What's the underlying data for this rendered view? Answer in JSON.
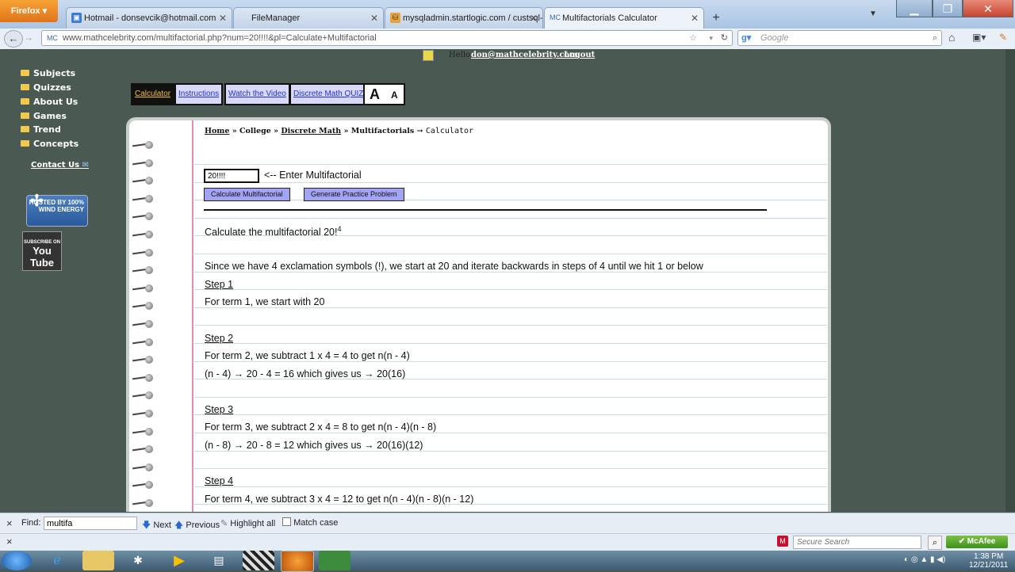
{
  "browser": {
    "menu_button": "Firefox",
    "tabs": [
      {
        "label": "Hotmail - donsevcik@hotmail.com",
        "active": false
      },
      {
        "label": "FileManager",
        "active": false
      },
      {
        "label": "mysqladmin.startlogic.com / custsql-...",
        "active": false
      },
      {
        "label": "Multifactorials Calculator",
        "active": true
      }
    ],
    "new_tab": "+",
    "url": "www.mathcelebrity.com/multifactorial.php?num=20!!!!&pl=Calculate+Multifactorial",
    "search_placeholder": "Google",
    "site_favicon": "MC"
  },
  "header": {
    "hello": "Hello",
    "user_email": "don@mathcelebrity.com",
    "logout": "Logout"
  },
  "sidebar": {
    "items": [
      {
        "label": "Subjects"
      },
      {
        "label": "Quizzes"
      },
      {
        "label": "About Us"
      },
      {
        "label": "Games"
      },
      {
        "label": "Trend"
      },
      {
        "label": "Concepts"
      }
    ],
    "contact": "Contact Us",
    "badge_wind": "HOSTED BY 100% WIND ENERGY",
    "badge_youtube_top": "SUBSCRIBE ON",
    "badge_youtube": "You Tube"
  },
  "toolbar": {
    "calculator": "Calculator",
    "instructions": "Instructions",
    "video": "Watch the Video",
    "quiz": "Discrete Math QUIZ",
    "font_up": "A",
    "font_down": "A"
  },
  "breadcrumb": {
    "home": "Home",
    "sep1": "»",
    "college": "College",
    "sep2": "»",
    "discrete": "Discrete Math",
    "sep3": "»",
    "multifactorials": "Multifactorials",
    "arrow": "→",
    "current": "Calculator"
  },
  "calculator": {
    "input_value": "20!!!!",
    "input_label": "<-- Enter Multifactorial",
    "calculate_button": "Calculate Multifactorial",
    "practice_button": "Generate Practice Problem"
  },
  "solution": {
    "heading": "Calculate the multifactorial 20!",
    "heading_sup": "4",
    "intro": "Since we have 4 exclamation symbols (!), we start at 20 and iterate backwards in steps of 4 until we hit 1 or below",
    "step1": "Step 1",
    "step1_line1": "For term 1, we start with 20",
    "step2": "Step 2",
    "step2_line1": "For term 2, we subtract 1 x 4 = 4 to get n(n - 4)",
    "step2_line2": "(n - 4) → 20 - 4 = 16 which gives us → 20(16)",
    "step3": "Step 3",
    "step3_line1": "For term 3, we subtract 2 x 4 = 8 to get n(n - 4)(n - 8)",
    "step3_line2": "(n - 8) → 20 - 8 = 12 which gives us → 20(16)(12)",
    "step4": "Step 4",
    "step4_line1": "For term 4, we subtract 3 x 4 = 12 to get n(n - 4)(n - 8)(n - 12)"
  },
  "findbar": {
    "close": "×",
    "label": "Find:",
    "value": "multifa",
    "next": "Next",
    "previous": "Previous",
    "highlight": "Highlight all",
    "match_case": "Match case"
  },
  "statusbar": {
    "close": "×",
    "secure_search_placeholder": "Secure Search",
    "mcafee": "McAfee"
  },
  "taskbar": {
    "time": "1:38 PM",
    "date": "12/21/2011"
  }
}
